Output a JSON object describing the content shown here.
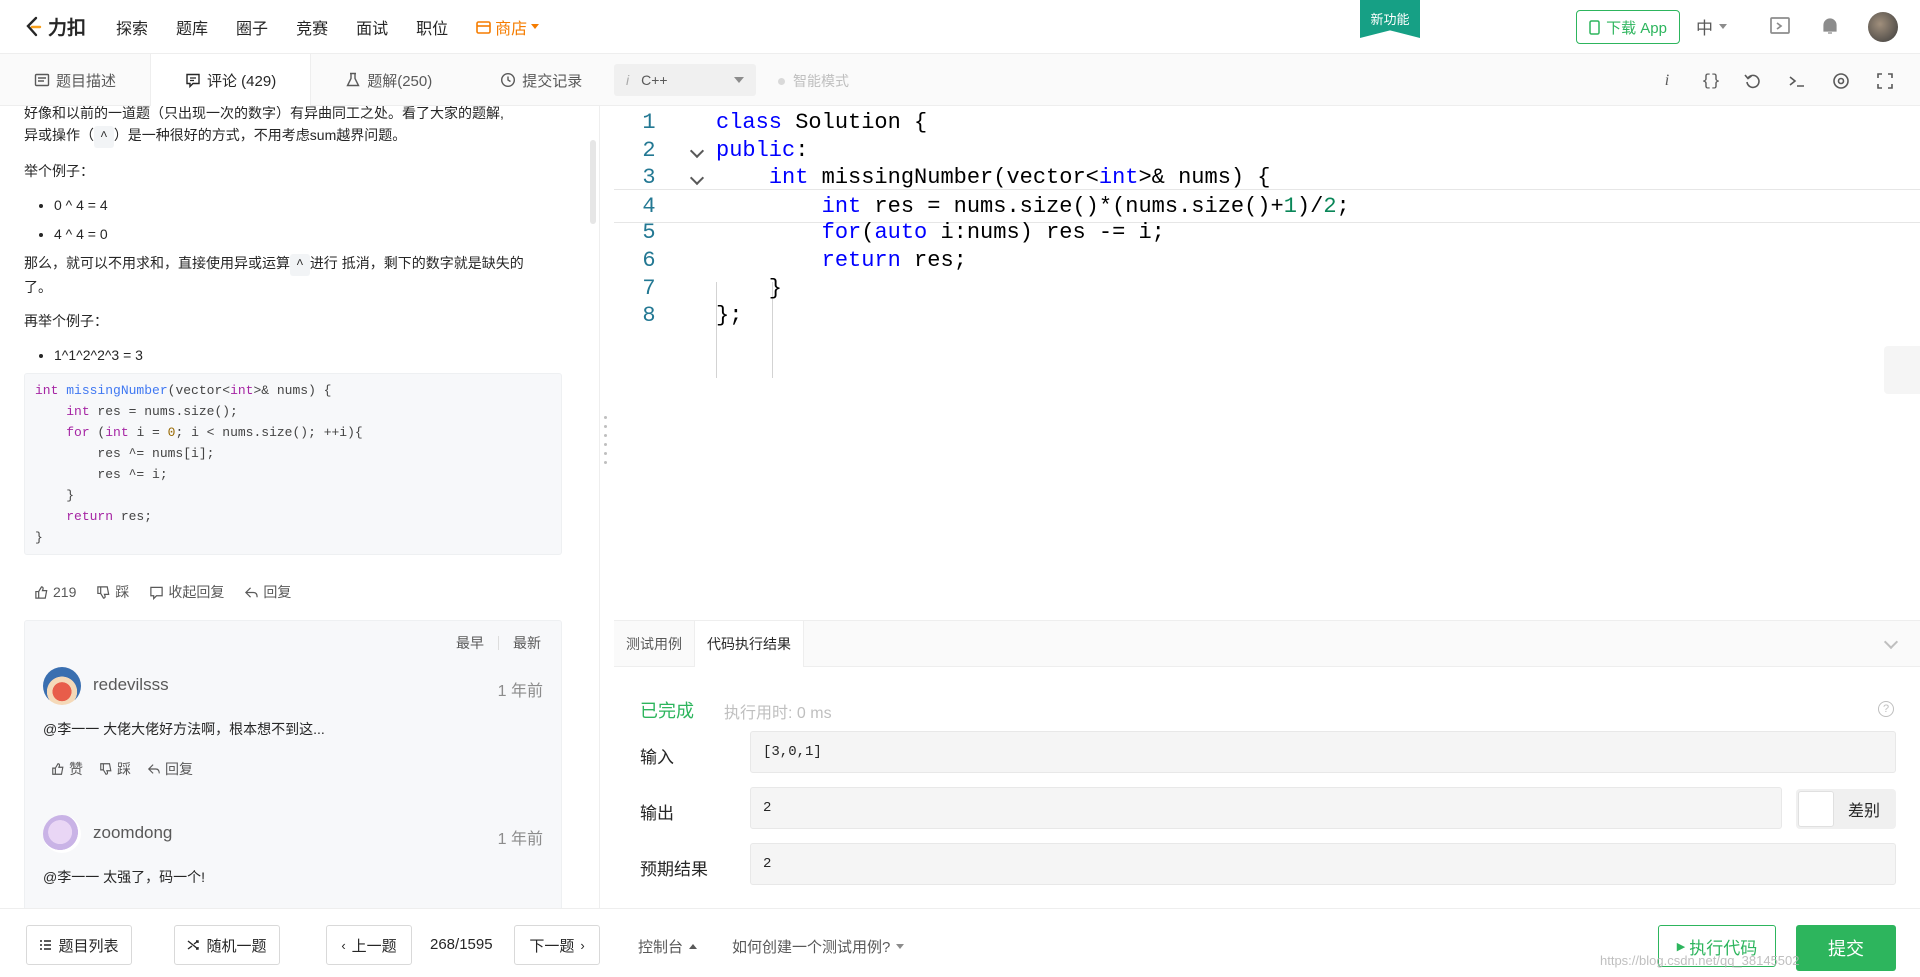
{
  "brand": {
    "name": "力扣"
  },
  "nav": {
    "links": [
      "探索",
      "题库",
      "圈子",
      "竞赛",
      "面试",
      "职位"
    ],
    "shop": "商店",
    "new_feature": "新功能",
    "download_app": "下载 App",
    "lang": "中"
  },
  "tabs": [
    {
      "label": "题目描述",
      "icon": "doc-icon"
    },
    {
      "label": "评论 (429)",
      "icon": "comment-icon"
    },
    {
      "label": "题解(250)",
      "icon": "flask-icon"
    },
    {
      "label": "提交记录",
      "icon": "clock-icon"
    }
  ],
  "editor_toolbar": {
    "language": "C++",
    "smart_mode": "智能模式"
  },
  "comment": {
    "line1": "好像和以前的一道题（只出现一次的数字）有异曲同工之处。看了大家的题解,",
    "line2_a": "异或操作（",
    "line2_code": "^",
    "line2_b": "）是一种很好的方式，不用考虑sum越界问题。",
    "example1_label": "举个例子：",
    "example1_items": [
      "0 ^ 4 = 4",
      "4 ^ 4 = 0"
    ],
    "para_a": "那么，就可以不用求和，直接使用异或运算",
    "para_code": "^",
    "para_b": "进行 抵消，剩下的数字就是缺失的",
    "para_c": "了。",
    "example2_label": "再举个例子：",
    "example2_items": [
      "1^1^2^2^3 = 3"
    ],
    "code_lines": [
      "int missingNumber(vector<int>& nums) {",
      "    int res = nums.size();",
      "    for (int i = 0; i < nums.size(); ++i){",
      "        res ^= nums[i];",
      "        res ^= i;",
      "    }",
      "    return res;",
      "}"
    ],
    "actions": {
      "likes": "219",
      "dislike": "踩",
      "collapse": "收起回复",
      "reply": "回复"
    }
  },
  "replies": {
    "sort_earliest": "最早",
    "sort_latest": "最新",
    "items": [
      {
        "user": "redevilsss",
        "time": "1 年前",
        "text": "@李一一 大佬大佬好方法啊，根本想不到这...",
        "like": "赞",
        "dislike": "踩",
        "reply": "回复"
      },
      {
        "user": "zoomdong",
        "time": "1 年前",
        "text": "@李一一 太强了，码一个!"
      }
    ]
  },
  "editor": {
    "lines": [
      {
        "n": "1",
        "html": "<span class=\"kw\">class</span> Solution {"
      },
      {
        "n": "2",
        "html": "<span class=\"kw\">public</span>:"
      },
      {
        "n": "3",
        "html": "    <span class=\"kw\">int</span> missingNumber(vector&lt;<span class=\"kw\">int</span>&gt;&amp; nums) {"
      },
      {
        "n": "4",
        "html": "        <span class=\"kw\">int</span> res = nums.size()*(nums.size()+<span class=\"num\">1</span>)/<span class=\"num\">2</span>;"
      },
      {
        "n": "5",
        "html": "        <span class=\"kw\">for</span>(<span class=\"kw\">auto</span> i:nums) res -= i;"
      },
      {
        "n": "6",
        "html": "        <span class=\"kw\">return</span> res;"
      },
      {
        "n": "7",
        "html": "    }"
      },
      {
        "n": "8",
        "html": "};"
      }
    ]
  },
  "result": {
    "tab_testcase": "测试用例",
    "tab_result": "代码执行结果",
    "status": "已完成",
    "exec_time": "执行用时: 0 ms",
    "input_label": "输入",
    "input_value": "[3,0,1]",
    "output_label": "输出",
    "output_value": "2",
    "diff_label": "差别",
    "expected_label": "预期结果",
    "expected_value": "2"
  },
  "bottom": {
    "problem_list": "题目列表",
    "random": "随机一题",
    "prev": "上一题",
    "page": "268/1595",
    "next": "下一题",
    "console": "控制台",
    "howto": "如何创建一个测试用例?",
    "run": "执行代码",
    "submit": "提交",
    "watermark": "https://blog.csdn.net/qq_38145502"
  },
  "colors": {
    "accent": "#2db55d",
    "shop": "#f57c00",
    "new_feature": "#16a085"
  }
}
